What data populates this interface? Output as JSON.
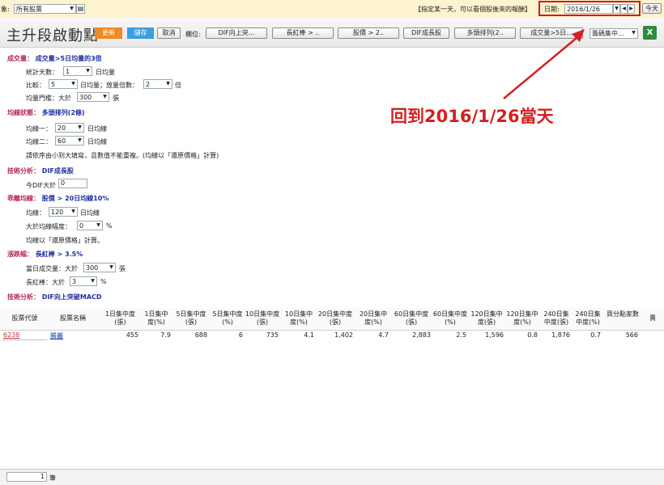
{
  "topbar": {
    "scope_label": "象:",
    "scope_value": "所有股票",
    "hint": "【指定某一天，可以看個股後來的報酬】",
    "date_label": "日期:",
    "date_value": "2016/1/26",
    "today_label": "今天"
  },
  "toolbar": {
    "title": "主升段啟動點",
    "update": "更新",
    "save": "儲存",
    "cancel": "取消",
    "columns_label": "欄位:",
    "columns": [
      "DIF向上突...",
      "長紅棒 > ..",
      "股價 > 2..",
      "DIF成長股",
      "多頭排列(2..",
      "成交量>5日..."
    ],
    "group_select": "籌碼集中..."
  },
  "conditions": {
    "s1_title": "成交量：",
    "s1_value": "成交量>5日均量的3倍",
    "s1_days_label": "統計天數：",
    "s1_days": "1",
    "s1_days_unit": "日均量",
    "s1_ratio_label": "比較：",
    "s1_ratio": "5",
    "s1_ratio_mid": "日均量；放量倍數：",
    "s1_mult": "2",
    "s1_mult_unit": "倍",
    "s1_thresh_label": "均量門檻：大於",
    "s1_thresh": "300",
    "s1_thresh_unit": "張",
    "s2_title": "均線狀態：",
    "s2_value": "多頭排列(2條)",
    "s2_ma1_label": "均線一：",
    "s2_ma1": "20",
    "s2_ma1_unit": "日均線",
    "s2_ma2_label": "均線二：",
    "s2_ma2": "60",
    "s2_ma2_unit": "日均線",
    "s2_note": "請依序由小到大填寫，且數值不能重複。(均線以「還原價格」計算)",
    "s3_title": "技術分析：",
    "s3_value": "DIF成長股",
    "s3_dif_label": "今DIF大於",
    "s3_dif": "0",
    "s4_title": "乖離均線：",
    "s4_value": "股價 > 20日均線10%",
    "s4_ma_label": "均線：",
    "s4_ma": "120",
    "s4_ma_unit": "日均線",
    "s4_dev_label": "大於均線幅度：",
    "s4_dev": "0",
    "s4_dev_unit": "%",
    "s4_note": "均線以「還原價格」計算。",
    "s5_title": "漲跌幅：",
    "s5_value": "長紅棒 > 3.5%",
    "s5_vol_label": "當日成交量：大於",
    "s5_vol": "300",
    "s5_vol_unit": "張",
    "s5_bar_label": "長紅棒：大於",
    "s5_bar": "3",
    "s5_bar_unit": "%",
    "s6_title": "技術分析：",
    "s6_value": "DIF向上突破MACD"
  },
  "annotation": "回到2016/1/26當天",
  "table": {
    "headers": [
      "股票代號",
      "股票名稱",
      "1日集中度(張)",
      "1日集中度(%)",
      "5日集中度(張)",
      "5日集中度(%)",
      "10日集中度(張)",
      "10日集中度(%)",
      "20日集中度(張)",
      "20日集中度(%)",
      "60日集中度(張)",
      "60日集中度(%)",
      "120日集中度(張)",
      "120日集中度(%)",
      "240日集中度(張)",
      "240日集中度(%)",
      "買分點家數",
      "賣"
    ],
    "rows": [
      [
        "6238",
        "勝麗",
        "455",
        "7.9",
        "688",
        "6",
        "735",
        "4.1",
        "1,402",
        "4.7",
        "2,883",
        "2.5",
        "1,596",
        "0.8",
        "1,876",
        "0.7",
        "566",
        ""
      ]
    ]
  },
  "footer": {
    "count": "1",
    "count_unit": "筆"
  },
  "colors": {
    "accent_orange": "#f08a24",
    "accent_blue": "#3d9ee0",
    "annotation_red": "#d42020",
    "section_red": "#b5284f",
    "section_blue": "#1f2fa0"
  }
}
